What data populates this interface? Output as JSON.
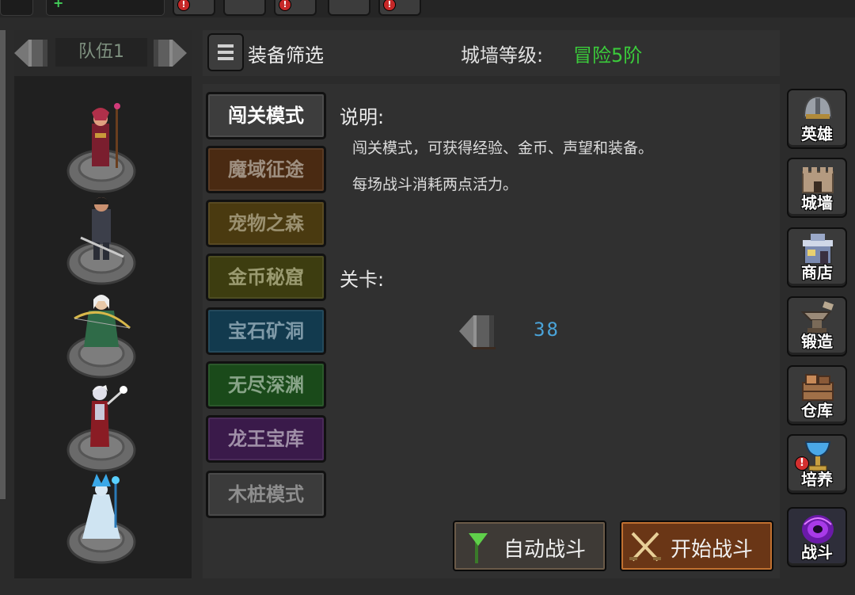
{
  "team": {
    "name": "队伍1",
    "heroes": [
      {
        "id": "mage-red"
      },
      {
        "id": "knight-armor"
      },
      {
        "id": "elf-archer"
      },
      {
        "id": "dark-sorceress"
      },
      {
        "id": "ice-mage"
      }
    ]
  },
  "filter": {
    "label": "装备筛选",
    "wall_level_label": "城墙等级:",
    "wall_level_value": "冒险5阶"
  },
  "modes": [
    {
      "label": "闯关模式",
      "selected": true,
      "bg": "#3d3d3d",
      "color": "#ffffff"
    },
    {
      "label": "魔域征途",
      "bg": "#4a2a12",
      "color": "#9e8f80"
    },
    {
      "label": "宠物之森",
      "bg": "#4a3a10",
      "color": "#9a9070"
    },
    {
      "label": "金币秘窟",
      "bg": "#3d3d10",
      "color": "#9a9a70"
    },
    {
      "label": "宝石矿洞",
      "bg": "#123a4e",
      "color": "#7f9aa8"
    },
    {
      "label": "无尽深渊",
      "bg": "#1a4a1a",
      "color": "#88a488"
    },
    {
      "label": "龙王宝库",
      "bg": "#3a1a4a",
      "color": "#a090a8"
    },
    {
      "label": "木桩模式",
      "bg": "#3b3b3b",
      "color": "#8e8e8e"
    }
  ],
  "description": {
    "title": "说明:",
    "lines": [
      "闯关模式，可获得经验、金币、声望和装备。",
      "每场战斗消耗两点活力。"
    ]
  },
  "stage": {
    "title": "关卡:",
    "number": "38"
  },
  "actions": {
    "auto": "自动战斗",
    "start": "开始战斗"
  },
  "side_menu": [
    {
      "label": "英雄",
      "icon": "helmet-icon"
    },
    {
      "label": "城墙",
      "icon": "wall-icon"
    },
    {
      "label": "商店",
      "icon": "shop-icon"
    },
    {
      "label": "锻造",
      "icon": "anvil-icon"
    },
    {
      "label": "仓库",
      "icon": "crate-icon"
    },
    {
      "label": "培养",
      "icon": "chalice-icon",
      "alert": true
    },
    {
      "label": "战斗",
      "icon": "portal-icon"
    }
  ]
}
